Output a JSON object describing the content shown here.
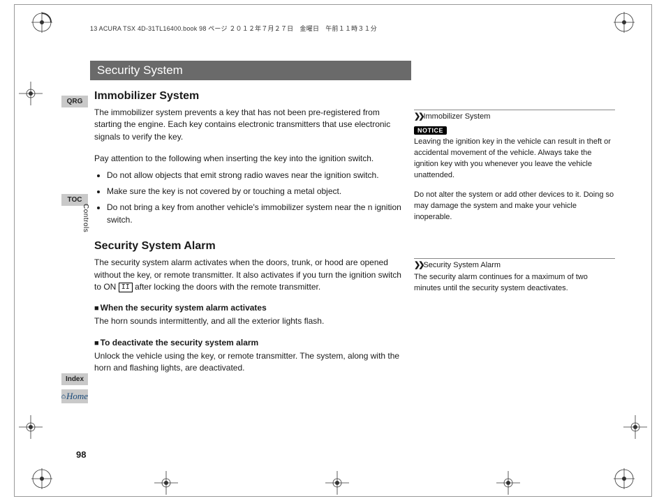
{
  "header_line": "13 ACURA TSX 4D-31TL16400.book  98 ページ  ２０１２年７月２７日　金曜日　午前１１時３１分",
  "section_title": "Security System",
  "tabs": {
    "qrg": "QRG",
    "toc": "TOC",
    "index": "Index",
    "home": "Home"
  },
  "vertical_label": "Controls",
  "page_number": "98",
  "main": {
    "s1": {
      "heading": "Immobilizer System",
      "p1": "The immobilizer system prevents a key that has not been pre-registered from starting the engine. Each key contains electronic transmitters that use electronic signals to verify the key.",
      "p2": "Pay attention to the following when inserting the key into the ignition switch.",
      "bullets": [
        "Do not allow objects that emit strong radio waves near the ignition switch.",
        "Make sure the key is not covered by or touching a metal object.",
        "Do not bring a key from another vehicle's immobilizer system near the n ignition switch."
      ]
    },
    "s2": {
      "heading": "Security System Alarm",
      "p1a": "The security system alarm activates when the doors, trunk, or hood are opened without the key, or remote transmitter. It also activates if you turn the ignition switch to ON ",
      "p1_box": "II",
      "p1b": " after locking the doors with the remote transmitter.",
      "sub1_title": "When the security system alarm activates",
      "sub1_body": "The horn sounds intermittently, and all the exterior lights flash.",
      "sub2_title": "To deactivate the security system alarm",
      "sub2_body": "Unlock the vehicle using the key, or remote transmitter. The system, along with the horn and flashing lights, are deactivated."
    }
  },
  "right": {
    "r1": {
      "title": "Immobilizer System",
      "notice": "NOTICE",
      "p1": "Leaving the ignition key in the vehicle can result in theft or accidental movement of the vehicle. Always take the ignition key with you whenever you leave the vehicle unattended.",
      "p2": "Do not alter the system or add other devices to it. Doing so may damage the system and make your vehicle inoperable."
    },
    "r2": {
      "title": "Security System Alarm",
      "p1": "The security alarm continues for a maximum of two minutes until the security system deactivates."
    }
  }
}
